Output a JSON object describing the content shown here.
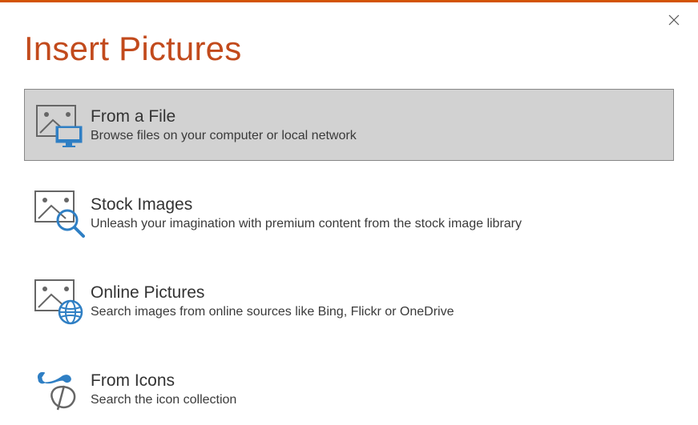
{
  "colors": {
    "accent_top": "#d35400",
    "title": "#c24a1c",
    "blue": "#2f7fc4",
    "selected_bg": "#d2d2d2"
  },
  "dialog": {
    "title": "Insert Pictures"
  },
  "options": [
    {
      "title": "From a File",
      "description": "Browse files on your computer or local network",
      "icon": "file-monitor",
      "selected": true
    },
    {
      "title": "Stock Images",
      "description": "Unleash your imagination with premium content from the stock image library",
      "icon": "stock-magnifier",
      "selected": false
    },
    {
      "title": "Online Pictures",
      "description": "Search images from online sources like Bing, Flickr or OneDrive",
      "icon": "online-globe",
      "selected": false
    },
    {
      "title": "From Icons",
      "description": "Search the icon collection",
      "icon": "icons-collection",
      "selected": false
    }
  ]
}
